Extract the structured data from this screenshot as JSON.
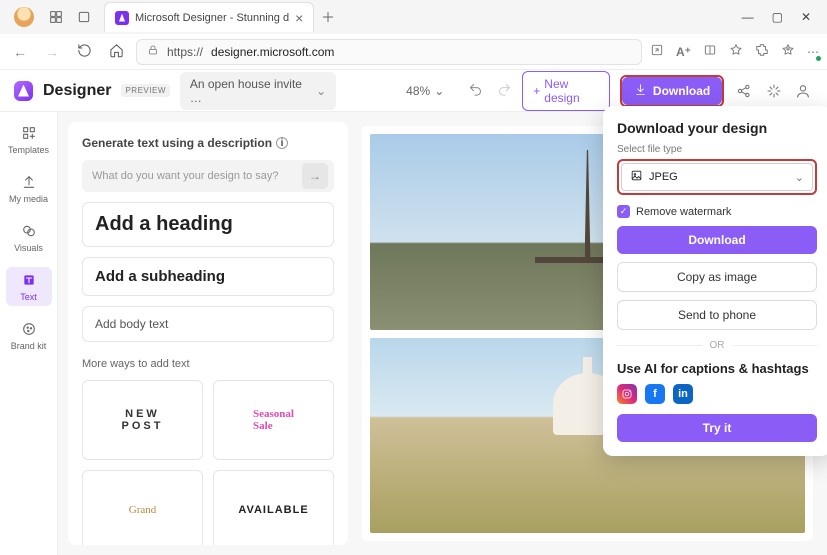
{
  "browser": {
    "tab_title": "Microsoft Designer - Stunning d",
    "url_proto": "https://",
    "url_host": "designer.microsoft.com"
  },
  "header": {
    "brand": "Designer",
    "preview_badge": "PREVIEW",
    "project_name": "An open house invite …",
    "zoom": "48%",
    "new_design": "New design",
    "download": "Download"
  },
  "rail": {
    "templates": "Templates",
    "my_media": "My media",
    "visuals": "Visuals",
    "text": "Text",
    "brand_kit": "Brand kit"
  },
  "textpanel": {
    "generate_label": "Generate text using a description",
    "prompt_placeholder": "What do you want your design to say?",
    "heading": "Add a heading",
    "subheading": "Add a subheading",
    "body": "Add body text",
    "more_ways": "More ways to add text",
    "ex_new_line1": "NEW",
    "ex_new_line2": "POST",
    "ex_seasonal_line1": "Seasonal",
    "ex_seasonal_line2": "Sale",
    "ex_grand": "Grand",
    "ex_available": "AVAILABLE"
  },
  "popover": {
    "title": "Download your design",
    "select_label": "Select file type",
    "file_type": "JPEG",
    "remove_watermark": "Remove watermark",
    "download_btn": "Download",
    "copy_btn": "Copy as image",
    "send_btn": "Send to phone",
    "or": "OR",
    "ai_title": "Use AI for captions & hashtags",
    "try_it": "Try it"
  }
}
